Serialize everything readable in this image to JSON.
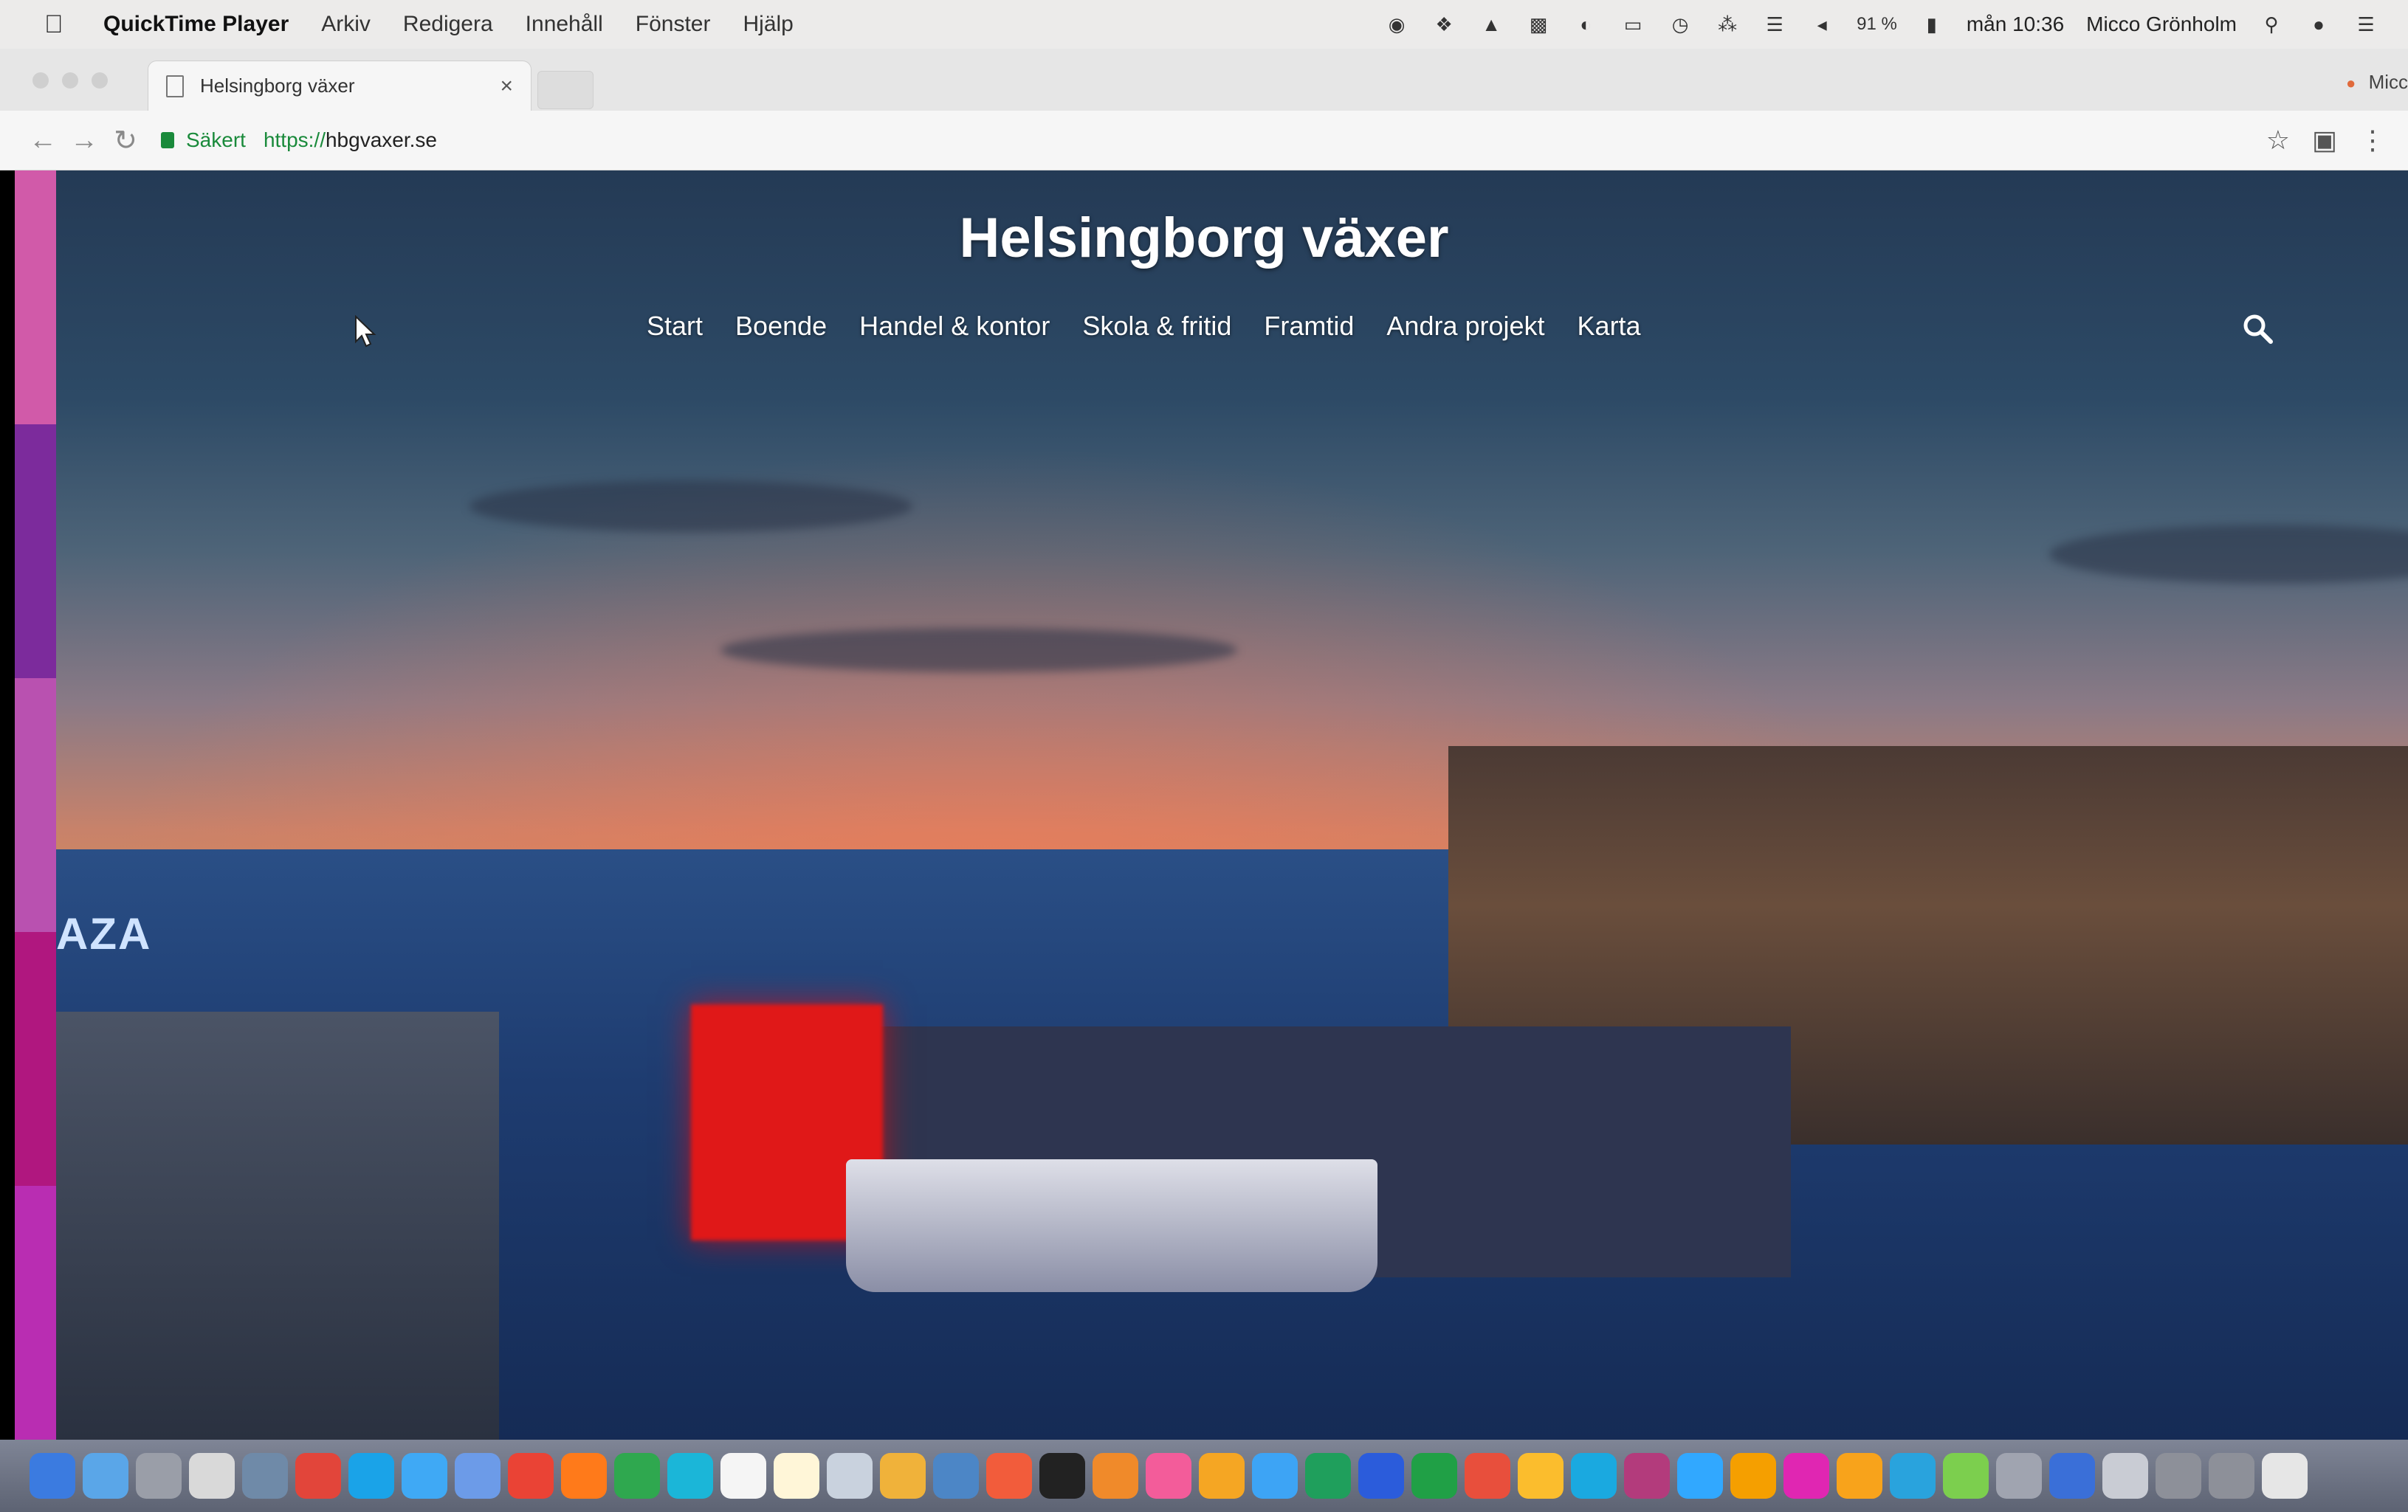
{
  "menubar": {
    "apple": "",
    "app_name": "QuickTime Player",
    "menus": [
      "Arkiv",
      "Redigera",
      "Innehåll",
      "Fönster",
      "Hjälp"
    ],
    "battery": "91 %",
    "clock": "mån 10:36",
    "user": "Micco Grönholm"
  },
  "browser": {
    "tab_title": "Helsingborg växer",
    "tab_close": "×",
    "profile_label": "Micc",
    "secure_label": "Säkert",
    "url_scheme": "https://",
    "url_host": "hbgvaxer.se"
  },
  "site": {
    "title": "Helsingborg växer",
    "nav": [
      "Start",
      "Boende",
      "Handel & kontor",
      "Skola & fritid",
      "Framtid",
      "Andra projekt",
      "Karta"
    ],
    "sign_text": "AZA"
  },
  "colors": {
    "strip": [
      "#d15aa9",
      "#7c2b9c",
      "#b951b0",
      "#b0177f",
      "#b92db2"
    ],
    "dock": [
      "#3b7be0",
      "#5aa6e8",
      "#9a9ea8",
      "#d9d9d9",
      "#6f8aa8",
      "#e2453a",
      "#1aa3e8",
      "#3fa9f5",
      "#6c9be8",
      "#ea4335",
      "#ff7a1a",
      "#2fa84f",
      "#1bb6d8",
      "#f5f5f5",
      "#fff6d8",
      "#c9d2de",
      "#f0b23a",
      "#4c86c6",
      "#f25c3b",
      "#222222",
      "#f08a2a",
      "#f35c9a",
      "#f5a623",
      "#3da4f5",
      "#1f9f5c",
      "#2b5cdb",
      "#20a046",
      "#e84f3c",
      "#fbbd2d",
      "#1aa9e0",
      "#b33b7c",
      "#31a8ff",
      "#f59f00",
      "#e026b2",
      "#f8a31b",
      "#29a3dd",
      "#7ccf4e",
      "#a0a4b0",
      "#3a6fd8",
      "#c9ccd4",
      "#8d9099",
      "#8d9099",
      "#e6e6e6"
    ]
  }
}
